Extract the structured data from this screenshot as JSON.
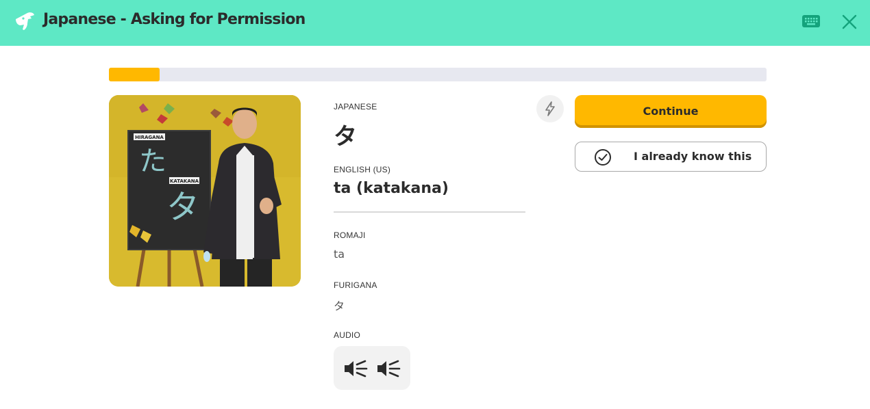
{
  "header": {
    "title": "Japanese - Asking for Permission",
    "icons": {
      "logo": "pointing-hand-logo",
      "keyboard": "keyboard-icon",
      "close": "close-icon"
    },
    "background_color": "#5ee8c5"
  },
  "progress": {
    "fraction": 0.077,
    "fill_color": "#ffb800",
    "track_color": "#e7e8f0"
  },
  "video": {
    "board_labels": {
      "hiragana": "HIRAGANA",
      "katakana": "KATAKANA"
    },
    "board_chars": {
      "hiragana": "た",
      "katakana": "タ"
    }
  },
  "card": {
    "japanese_label": "JAPANESE",
    "japanese_value": "タ",
    "english_label": "ENGLISH (US)",
    "english_value": "ta (katakana)",
    "romaji_label": "ROMAJI",
    "romaji_value": "ta",
    "furigana_label": "FURIGANA",
    "furigana_value": "タ",
    "audio_label": "AUDIO"
  },
  "actions": {
    "bolt_icon": "lightning-bolt-icon",
    "continue_label": "Continue",
    "know_label": "I already know this",
    "accent_color": "#ffb800"
  }
}
